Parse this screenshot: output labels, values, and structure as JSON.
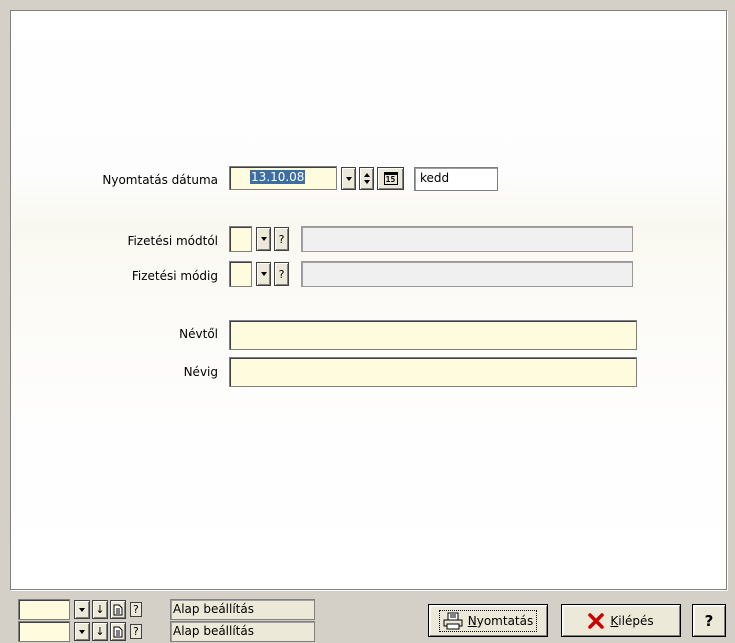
{
  "form": {
    "print_date": {
      "label": "Nyomtatás dátuma",
      "value": "13.10.08",
      "weekday": "kedd",
      "icons": [
        "dropdown-icon",
        "spin-icon",
        "calendar-icon"
      ],
      "calendar_icon_text": "15"
    },
    "payment_from": {
      "label": "Fizetési módtól",
      "code": "",
      "help": "?",
      "description": ""
    },
    "payment_to": {
      "label": "Fizetési módig",
      "code": "",
      "help": "?",
      "description": ""
    },
    "name_from": {
      "label": "Névtől",
      "value": ""
    },
    "name_to": {
      "label": "Névig",
      "value": ""
    }
  },
  "footer": {
    "settings_rows": [
      {
        "value": "",
        "help": "?",
        "label": "Alap beállítás",
        "icons": [
          "dropdown-icon",
          "down-arrow-icon",
          "document-icon",
          "help-icon"
        ]
      },
      {
        "value": "",
        "help": "?",
        "label": "Alap beállítás",
        "icons": [
          "dropdown-icon",
          "down-arrow-icon",
          "document-icon",
          "help-icon"
        ]
      }
    ],
    "print_button": {
      "mnemonic": "N",
      "rest": "yomtatás",
      "icon": "printer-icon"
    },
    "exit_button": {
      "mnemonic": "K",
      "rest": "ilépés",
      "icon": "close-x-icon",
      "icon_color": "#cc0000"
    },
    "help_button": {
      "label": "?"
    }
  },
  "colors": {
    "field_yellow": "#fffbdf",
    "selection_blue": "#3a6ea5",
    "dialog_background": "#d4d0c8"
  }
}
